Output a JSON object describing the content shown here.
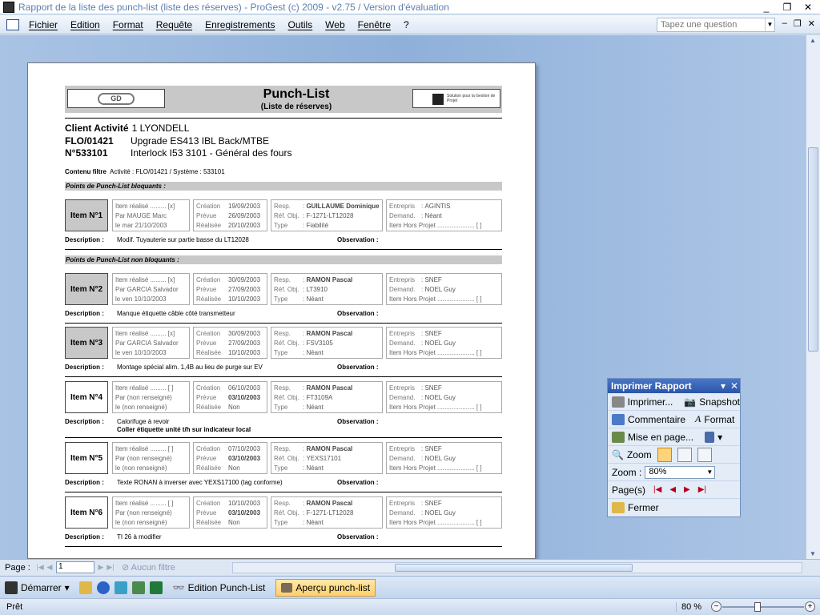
{
  "window": {
    "title": "Rapport de la liste des punch-list (liste des réserves) - ProGest (c) 2009 - v2.75 / Version d'évaluation",
    "controls": [
      "_",
      "❐",
      "✕"
    ]
  },
  "menu": {
    "items": [
      "Fichier",
      "Edition",
      "Format",
      "Requête",
      "Enregistrements",
      "Outils",
      "Web",
      "Fenêtre",
      "?"
    ],
    "ask_placeholder": "Tapez une question",
    "mdi": [
      "–",
      "❐",
      "✕"
    ]
  },
  "report": {
    "title": "Punch-List",
    "subtitle": "(Liste de réserves)",
    "logo1": "GD",
    "logo2": "Solution pour la Gestion de Projet",
    "client_label": "Client Activité",
    "client_value": "1 LYONDELL",
    "flo_label": "FLO/01421",
    "flo_value": "Upgrade ES413 IBL Back/MTBE",
    "n_label": "N°533101",
    "n_value": "Interlock I53 3101 - Général des fours",
    "filtre_label": "Contenu filtre",
    "filtre_value": "Activité : FLO/01421 / Système : 533101",
    "sec_bloquants": "Points de Punch-List bloquants :",
    "sec_non_bloquants": "Points de Punch-List non bloquants :",
    "description_label": "Description :",
    "observation_label": "Observation :",
    "items": [
      {
        "badge": "Item N°1",
        "realise": "Item réalisé ......... [x]",
        "par": "Par MAUGE Marc",
        "le": "le   mar 21/10/2003",
        "creation": "19/09/2003",
        "prevue": "26/09/2003",
        "realisee": "20/10/2003",
        "resp": "GUILLAUME Dominique",
        "refobj": "F-1271-LT12028",
        "type": "Fiabilité",
        "entrepris": "AGINTIS",
        "demand": "Néant",
        "hors": "Item Hors Projet ..................... [ ]",
        "desc": "Modif. Tuyauterie sur partie basse du LT12028",
        "desc2": ""
      },
      {
        "badge": "Item N°2",
        "realise": "Item réalisé ......... [x]",
        "par": "Par GARCIA Salvador",
        "le": "le    ven 10/10/2003",
        "creation": "30/09/2003",
        "prevue": "27/09/2003",
        "realisee": "10/10/2003",
        "resp": "RAMON Pascal",
        "refobj": "LT3910",
        "type": "Néant",
        "entrepris": "SNEF",
        "demand": "NOEL Guy",
        "hors": "Item Hors Projet ..................... [ ]",
        "desc": "Manque étiquette câble côté transmetteur",
        "desc2": ""
      },
      {
        "badge": "Item N°3",
        "realise": "Item réalisé ......... [x]",
        "par": "Par GARCIA Salvador",
        "le": "le    ven 10/10/2003",
        "creation": "30/09/2003",
        "prevue": "27/09/2003",
        "realisee": "10/10/2003",
        "resp": "RAMON Pascal",
        "refobj": "FSV3105",
        "type": "Néant",
        "entrepris": "SNEF",
        "demand": "NOEL Guy",
        "hors": "Item Hors Projet ..................... [ ]",
        "desc": "Montage spécial alim. 1,4B au lieu de purge sur EV",
        "desc2": ""
      },
      {
        "badge": "Item N°4",
        "realise": "Item réalisé ......... [ ]",
        "par": "Par  (non renseigné)",
        "le": "le    (non renseigné)",
        "creation": "06/10/2003",
        "prevue": "03/10/2003",
        "realisee": "Non",
        "resp": "RAMON Pascal",
        "refobj": "FT3109A",
        "type": "Néant",
        "entrepris": "SNEF",
        "demand": "NOEL Guy",
        "hors": "Item Hors Projet ..................... [ ]",
        "desc": "Calorifuge à revoir",
        "desc2": "Coller étiquette unité t/h sur indicateur local"
      },
      {
        "badge": "Item N°5",
        "realise": "Item réalisé ......... [ ]",
        "par": "Par  (non renseigné)",
        "le": "le    (non renseigné)",
        "creation": "07/10/2003",
        "prevue": "03/10/2003",
        "realisee": "Non",
        "resp": "RAMON Pascal",
        "refobj": "YEXS17101",
        "type": "Néant",
        "entrepris": "SNEF",
        "demand": "NOEL Guy",
        "hors": "Item Hors Projet ..................... [ ]",
        "desc": "Texte RONAN à inverser avec YEXS17100 (tag conforme)",
        "desc2": ""
      },
      {
        "badge": "Item N°6",
        "realise": "Item réalisé ......... [ ]",
        "par": "Par  (non renseigné)",
        "le": "le    (non renseigné)",
        "creation": "10/10/2003",
        "prevue": "03/10/2003",
        "realisee": "Non",
        "resp": "RAMON Pascal",
        "refobj": "F-1271-LT12028",
        "type": "Néant",
        "entrepris": "SNEF",
        "demand": "NOEL Guy",
        "hors": "Item Hors Projet ..................... [ ]",
        "desc": "TI 26 à modifier",
        "desc2": ""
      }
    ],
    "labels": {
      "creation": "Création",
      "prevue": "Prévue",
      "realisee": "Réalisée",
      "resp": "Resp.",
      "refobj": "Réf. Obj.",
      "type": "Type",
      "entrepris": "Entrepris",
      "demand": "Demand."
    }
  },
  "nav": {
    "page_label": "Page :",
    "page_value": "1",
    "no_filter": "Aucun filtre"
  },
  "taskbar": {
    "start": "Démarrer",
    "task1": "Edition Punch-List",
    "task2": "Aperçu punch-list"
  },
  "status": {
    "text": "Prêt",
    "zoom": "80 %"
  },
  "print_panel": {
    "title": "Imprimer Rapport",
    "print": "Imprimer...",
    "snapshot": "Snapshot",
    "comment": "Commentaire",
    "format": "Format",
    "mise": "Mise en page...",
    "zoom": "Zoom",
    "zoom_label": "Zoom :",
    "zoom_value": "80%",
    "pages": "Page(s)",
    "close": "Fermer"
  }
}
